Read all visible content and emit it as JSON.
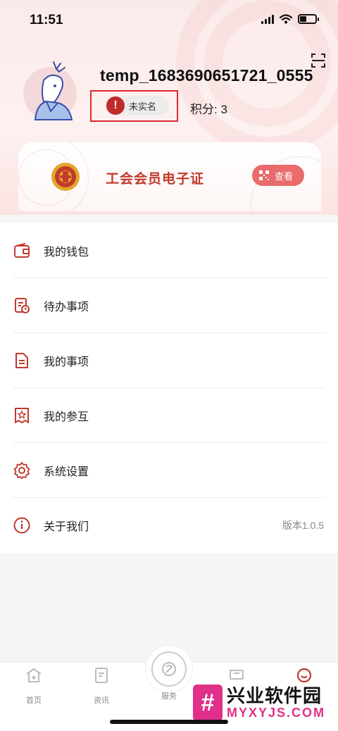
{
  "status_bar": {
    "time": "11:51"
  },
  "profile": {
    "username": "temp_1683690651721_0555",
    "verify_status": "未实名",
    "points": "积分: 3"
  },
  "card": {
    "title": "工会会员电子证",
    "view_label": "查看"
  },
  "menu": {
    "items": [
      {
        "label": "我的钱包",
        "icon": "wallet-icon"
      },
      {
        "label": "待办事项",
        "icon": "todo-icon"
      },
      {
        "label": "我的事项",
        "icon": "document-icon"
      },
      {
        "label": "我的参互",
        "icon": "star-document-icon"
      },
      {
        "label": "系统设置",
        "icon": "gear-icon"
      },
      {
        "label": "关于我们",
        "icon": "info-icon",
        "extra": "版本1.0.5"
      }
    ]
  },
  "tabbar": {
    "tabs": [
      {
        "label": "首页",
        "icon": "home-icon"
      },
      {
        "label": "资讯",
        "icon": "news-icon"
      },
      {
        "label": "服务",
        "icon": "service-icon"
      },
      {
        "label": "",
        "icon": "ticket-icon"
      },
      {
        "label": "",
        "icon": "profile-icon"
      }
    ]
  },
  "watermark": {
    "cn": "兴业软件园",
    "en": "MYXYJS.COM",
    "logo": "#"
  },
  "colors": {
    "accent": "#c0392b",
    "button": "#e96b6b",
    "verify_box": "#d92b2b",
    "watermark": "#e0308a"
  }
}
